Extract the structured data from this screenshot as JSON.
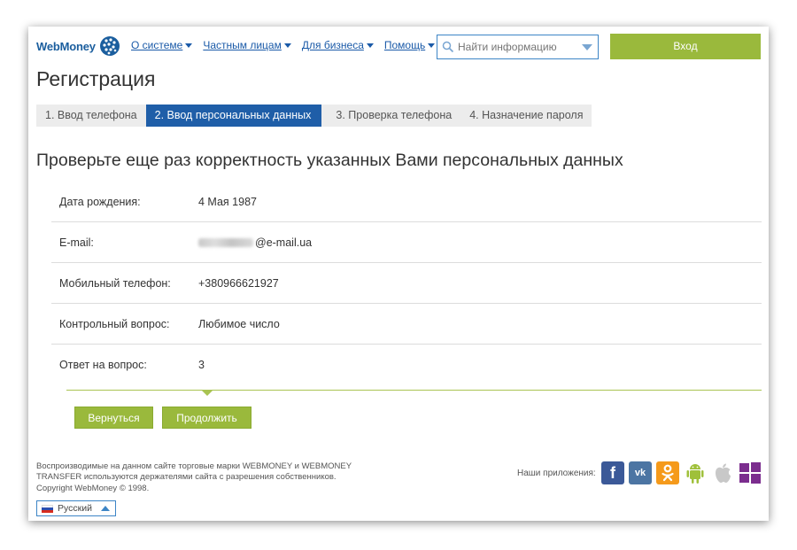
{
  "header": {
    "logo_text": "WebMoney",
    "nav": [
      {
        "label": "О системе"
      },
      {
        "label": "Частным лицам"
      },
      {
        "label": "Для бизнеса"
      },
      {
        "label": "Помощь"
      }
    ],
    "search_placeholder": "Найти информацию",
    "login_label": "Вход"
  },
  "page_title": "Регистрация",
  "steps": [
    {
      "label": "1. Ввод телефона",
      "active": false
    },
    {
      "label": "2. Ввод персональных данных",
      "active": true
    },
    {
      "label": "3. Проверка телефона",
      "active": false
    },
    {
      "label": "4. Назначение пароля",
      "active": false
    }
  ],
  "subtitle": "Проверьте еще раз корректность указанных Вами персональных данных",
  "fields": [
    {
      "label": "Дата рождения:",
      "value": "4 Мая 1987"
    },
    {
      "label": "E-mail:",
      "value": "@e-mail.ua",
      "masked_prefix": true
    },
    {
      "label": "Мобильный телефон:",
      "value": "+380966621927"
    },
    {
      "label": "Контрольный вопрос:",
      "value": "Любимое число"
    },
    {
      "label": "Ответ на вопрос:",
      "value": "3"
    }
  ],
  "buttons": {
    "back": "Вернуться",
    "continue": "Продолжить"
  },
  "footer": {
    "trademark_text": "Воспроизводимые на данном сайте торговые марки WEBMONEY и WEBMONEY TRANSFER используются держателями сайта с разрешения собственников.",
    "copyright": "Copyright WebMoney © 1998.",
    "language": "Русский",
    "apps_label": "Наши приложения:",
    "apps": [
      "facebook-icon",
      "vk-icon",
      "odnoklassniki-icon",
      "android-icon",
      "apple-icon",
      "windows-icon"
    ]
  },
  "colors": {
    "accent_green": "#9ab93c",
    "accent_blue": "#1f5ea8",
    "link_blue": "#1a5aa8"
  }
}
